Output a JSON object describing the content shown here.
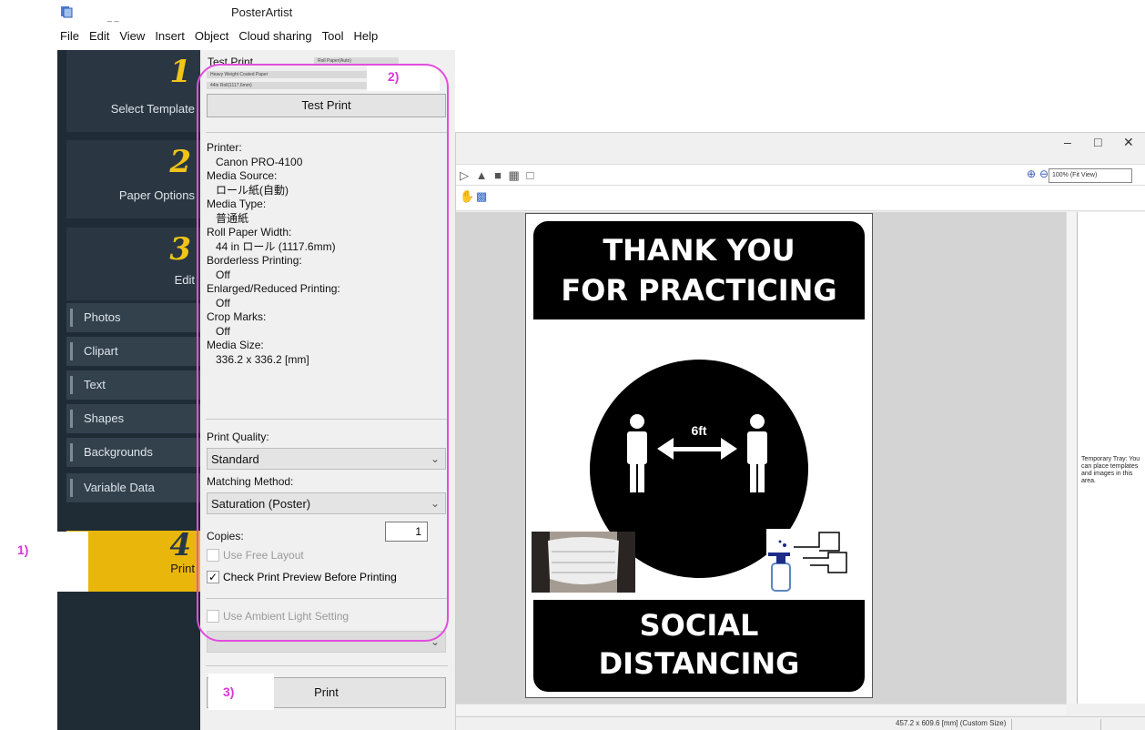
{
  "window": {
    "title": "PosterArtist",
    "title_bar_extra": "_ _"
  },
  "menu": [
    "File",
    "Edit",
    "View",
    "Insert",
    "Object",
    "Cloud sharing",
    "Tool",
    "Help"
  ],
  "steps": [
    {
      "num": "1",
      "label": "Select Template"
    },
    {
      "num": "2",
      "label": "Paper Options"
    },
    {
      "num": "3",
      "label": "Edit"
    },
    {
      "num": "4",
      "label": "Print"
    }
  ],
  "edit_items": [
    "Photos",
    "Clipart",
    "Text",
    "Shapes",
    "Backgrounds",
    "Variable Data"
  ],
  "test_print": {
    "heading": "Test Print",
    "media_source": "Roll Paper(Auto)",
    "media_type": "Heavy Weight Coated Paper",
    "roll_width": "44in Roll(1117.6mm)",
    "button": "Test Print"
  },
  "printer_info": {
    "printer_label": "Printer:",
    "printer_value": "Canon PRO-4100",
    "media_source_label": "Media Source:",
    "media_source_value": "ロール紙(自動)",
    "media_type_label": "Media Type:",
    "media_type_value": "普通紙",
    "roll_width_label": "Roll Paper Width:",
    "roll_width_value": "44 in ロール (1117.6mm)",
    "borderless_label": "Borderless Printing:",
    "borderless_value": "Off",
    "enlarged_label": "Enlarged/Reduced Printing:",
    "enlarged_value": "Off",
    "crop_label": "Crop Marks:",
    "crop_value": "Off",
    "media_size_label": "Media Size:",
    "media_size_value": "336.2 x 336.2 [mm]"
  },
  "print_quality": {
    "label": "Print Quality:",
    "value": "Standard"
  },
  "matching_method": {
    "label": "Matching Method:",
    "value": "Saturation (Poster)"
  },
  "copies": {
    "label": "Copies:",
    "value": "1"
  },
  "options": {
    "free_layout": "Use Free Layout",
    "check_preview": "Check Print Preview Before Printing",
    "ambient_light": "Use Ambient Light Setting"
  },
  "print_button": "Print",
  "annotations": [
    "1)",
    "2)",
    "3)"
  ],
  "preview": {
    "zoom": "100% (Fit View)",
    "tray_text": "Temporary Tray: You can place templates and images in this area.",
    "status": "457.2 x 609.6 [mm] (Custom Size)"
  },
  "poster": {
    "top_line1": "THANK YOU",
    "top_line2": "FOR PRACTICING",
    "distance": "6ft",
    "bottom_line1": "SOCIAL",
    "bottom_line2": "DISTANCING"
  }
}
